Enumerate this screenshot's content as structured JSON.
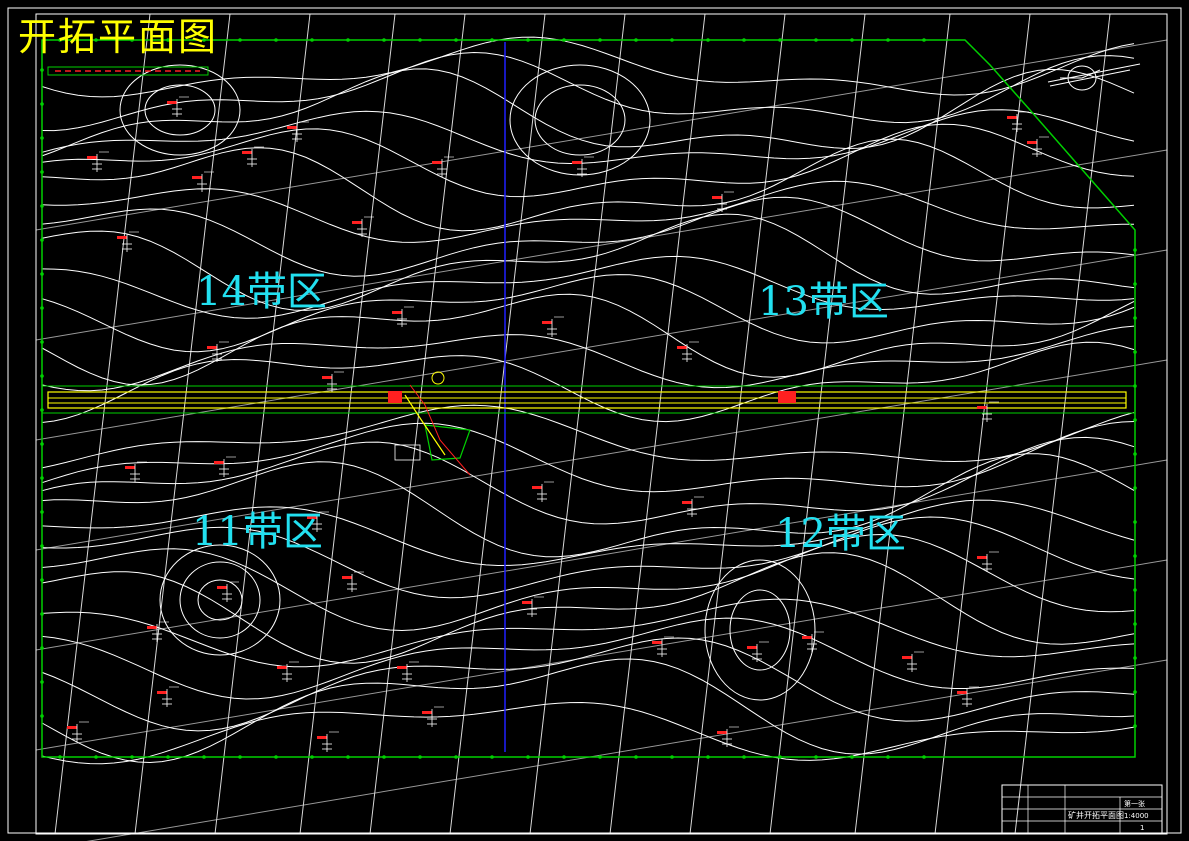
{
  "drawing": {
    "title": "开拓平面图",
    "zones": [
      {
        "id": "z14",
        "label": "14带区"
      },
      {
        "id": "z13",
        "label": "13带区"
      },
      {
        "id": "z11",
        "label": "11带区"
      },
      {
        "id": "z12",
        "label": "12带区"
      }
    ]
  },
  "title_block": {
    "project": "矿井开拓平面图",
    "scale": "1:4000",
    "sheet": "第一张",
    "sheet_count": "1"
  },
  "colors": {
    "background": "#000000",
    "contour": "#ffffff",
    "boundary": "#00d000",
    "roadway": "#ffff00",
    "zone_label": "#22e0f0",
    "title": "#ffff00",
    "divider": "#2020ff",
    "borehole_marker": "#ff2020"
  }
}
